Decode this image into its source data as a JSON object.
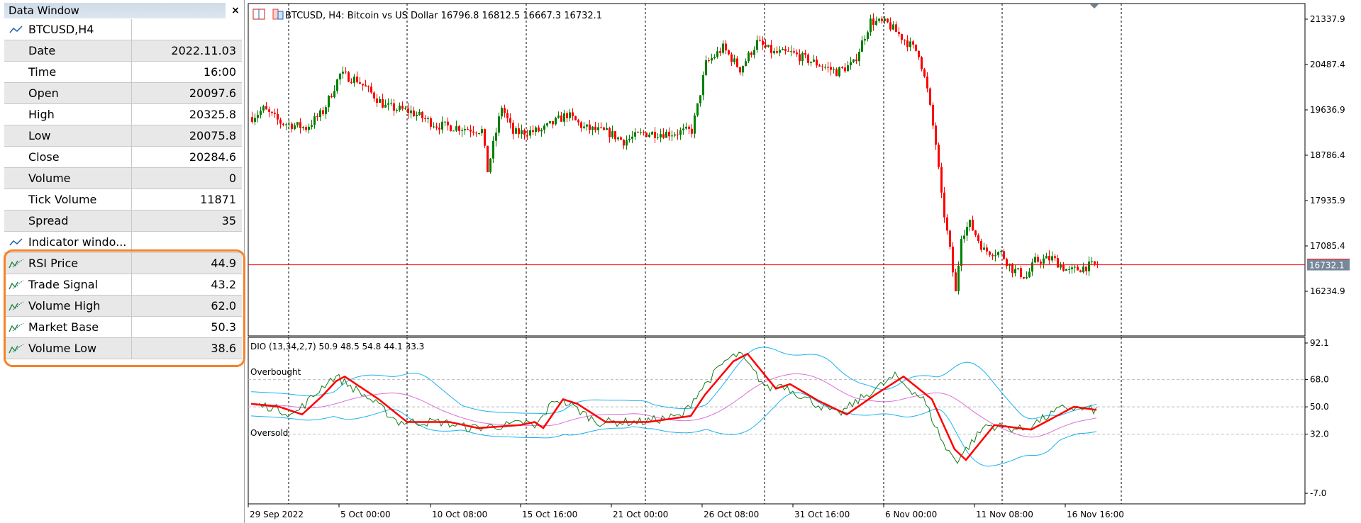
{
  "data_window": {
    "title": "Data Window",
    "close": "×",
    "symbol": "BTCUSD,H4",
    "rows": [
      {
        "label": "Date",
        "value": "2022.11.03"
      },
      {
        "label": "Time",
        "value": "16:00"
      },
      {
        "label": "Open",
        "value": "20097.6"
      },
      {
        "label": "High",
        "value": "20325.8"
      },
      {
        "label": "Low",
        "value": "20075.8"
      },
      {
        "label": "Close",
        "value": "20284.6"
      },
      {
        "label": "Volume",
        "value": "0"
      },
      {
        "label": "Tick Volume",
        "value": "11871"
      },
      {
        "label": "Spread",
        "value": "35"
      }
    ],
    "indicator_header": "Indicator windo...",
    "indicator_rows": [
      {
        "label": "RSI Price",
        "value": "44.9"
      },
      {
        "label": "Trade Signal",
        "value": "43.2"
      },
      {
        "label": "Volume High",
        "value": "62.0"
      },
      {
        "label": "Market Base",
        "value": "50.3"
      },
      {
        "label": "Volume Low",
        "value": "38.6"
      }
    ],
    "highlight_color": "#f5822a"
  },
  "chart": {
    "title": "BTCUSD, H4:  Bitcoin vs US Dollar  16796.8 16812.5 16667.3 16732.1",
    "indicator_title": "DIO (13,34,2,7) 50.9 48.5 54.8 44.1 33.3",
    "overbought": "Overbought",
    "oversold": "Oversold",
    "current_price": "16732.1",
    "up_color": "#008000",
    "down_color": "#ff0000"
  },
  "chart_data": {
    "type": "candlestick",
    "price_ticks": [
      "21337.9",
      "20487.4",
      "19636.9",
      "18786.4",
      "17935.9",
      "17085.4",
      "16234.9"
    ],
    "price_tick_values": [
      21337.9,
      20487.4,
      19636.9,
      18786.4,
      17935.9,
      17085.4,
      16234.9
    ],
    "indicator_ticks": [
      "92.1",
      "68.0",
      "50.0",
      "32.0",
      "-7.0"
    ],
    "indicator_tick_values": [
      92.1,
      68.0,
      50.0,
      32.0,
      -7.0
    ],
    "levels": [
      68,
      50,
      32
    ],
    "time_labels": [
      "29 Sep 2022",
      "5 Oct 00:00",
      "10 Oct 08:00",
      "15 Oct 16:00",
      "21 Oct 00:00",
      "26 Oct 08:00",
      "31 Oct 16:00",
      "6 Nov 00:00",
      "11 Nov 08:00",
      "16 Nov 16:00"
    ],
    "bars": 299,
    "price_path": [
      [
        0,
        19500
      ],
      [
        4,
        19650
      ],
      [
        10,
        19400
      ],
      [
        19,
        19300
      ],
      [
        25,
        19600
      ],
      [
        31,
        20300
      ],
      [
        37,
        20200
      ],
      [
        47,
        19700
      ],
      [
        56,
        19600
      ],
      [
        65,
        19350
      ],
      [
        74,
        19300
      ],
      [
        81,
        19250
      ],
      [
        83,
        18500
      ],
      [
        88,
        19700
      ],
      [
        92,
        19200
      ],
      [
        102,
        19250
      ],
      [
        111,
        19550
      ],
      [
        117,
        19300
      ],
      [
        126,
        19200
      ],
      [
        131,
        19050
      ],
      [
        138,
        19200
      ],
      [
        148,
        19200
      ],
      [
        155,
        19250
      ],
      [
        157,
        19700
      ],
      [
        160,
        20500
      ],
      [
        166,
        20800
      ],
      [
        172,
        20400
      ],
      [
        178,
        20900
      ],
      [
        184,
        20700
      ],
      [
        190,
        20700
      ],
      [
        197,
        20550
      ],
      [
        206,
        20350
      ],
      [
        212,
        20500
      ],
      [
        218,
        21300
      ],
      [
        224,
        21250
      ],
      [
        230,
        20950
      ],
      [
        235,
        20700
      ],
      [
        238,
        20000
      ],
      [
        241,
        19000
      ],
      [
        243,
        18000
      ],
      [
        246,
        17000
      ],
      [
        248,
        16200
      ],
      [
        250,
        17300
      ],
      [
        253,
        17500
      ],
      [
        258,
        17000
      ],
      [
        264,
        16950
      ],
      [
        268,
        16650
      ],
      [
        273,
        16500
      ],
      [
        276,
        16800
      ],
      [
        282,
        16850
      ],
      [
        288,
        16600
      ],
      [
        294,
        16700
      ],
      [
        298,
        16732
      ]
    ],
    "signal_path": [
      [
        0,
        52
      ],
      [
        10,
        50
      ],
      [
        18,
        45
      ],
      [
        25,
        57
      ],
      [
        30,
        67
      ],
      [
        33,
        70
      ],
      [
        45,
        55
      ],
      [
        55,
        40
      ],
      [
        70,
        40
      ],
      [
        80,
        36
      ],
      [
        95,
        38
      ],
      [
        100,
        40
      ],
      [
        103,
        36
      ],
      [
        110,
        55
      ],
      [
        115,
        52
      ],
      [
        125,
        40
      ],
      [
        140,
        40
      ],
      [
        155,
        44
      ],
      [
        160,
        58
      ],
      [
        170,
        80
      ],
      [
        175,
        85
      ],
      [
        185,
        62
      ],
      [
        190,
        65
      ],
      [
        200,
        54
      ],
      [
        210,
        45
      ],
      [
        220,
        58
      ],
      [
        230,
        70
      ],
      [
        240,
        55
      ],
      [
        248,
        22
      ],
      [
        252,
        15
      ],
      [
        262,
        38
      ],
      [
        275,
        35
      ],
      [
        290,
        50
      ],
      [
        298,
        48
      ]
    ]
  }
}
